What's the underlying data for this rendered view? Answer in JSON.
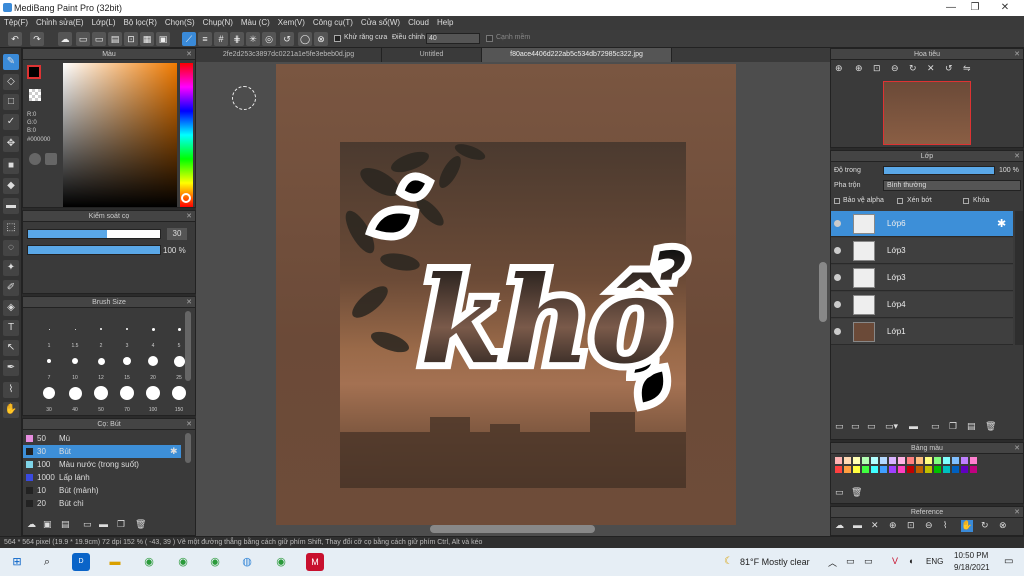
{
  "window": {
    "title": "MediBang Paint Pro (32bit)",
    "min": "—",
    "max": "❐",
    "close": "✕"
  },
  "menu": [
    "Tệp(F)",
    "Chỉnh sửa(E)",
    "Lớp(L)",
    "Bộ lọc(R)",
    "Chọn(S)",
    "Chụp(N)",
    "Màu (C)",
    "Xem(V)",
    "Công cụ(T)",
    "Cửa sổ(W)",
    "Cloud",
    "Help"
  ],
  "toolbar": {
    "antialias": "Khử răng cưa",
    "adjust_label": "Điều chỉnh",
    "adjust_value": "40",
    "soften": "Cạnh mềm"
  },
  "tabs": [
    "2fe2d253c3897dc0221a1e5fe3ebeb0d.jpg",
    "Untitled",
    "f80ace4406d222ab5c534db72985c322.jpg"
  ],
  "color_panel": {
    "title": "Màu",
    "r": "R:0",
    "g": "G:0",
    "b": "B:0",
    "hex": "#000000"
  },
  "brush_control": {
    "title": "Kiểm soát cọ",
    "size": "30",
    "opacity": "100 %",
    "size_fill": 0.6,
    "opacity_fill": 1.0
  },
  "brush_size": {
    "title": "Brush Size",
    "labels": [
      "1",
      "1.5",
      "2",
      "3",
      "4",
      "5",
      "7",
      "10",
      "12",
      "15",
      "20",
      "25",
      "30",
      "40",
      "50",
      "70",
      "100",
      "150"
    ]
  },
  "brush_list": {
    "title": "Cọ: Bút",
    "items": [
      {
        "num": "50",
        "name": "Mù",
        "color": "#e88ee0"
      },
      {
        "num": "30",
        "name": "Bút",
        "color": "#222222",
        "selected": true
      },
      {
        "num": "100",
        "name": "Màu nước (trong suốt)",
        "color": "#7fd4e8"
      },
      {
        "num": "1000",
        "name": "Lấp lánh",
        "color": "#3a4ae0"
      },
      {
        "num": "10",
        "name": "Bút (mảnh)",
        "color": "#222222"
      },
      {
        "num": "20",
        "name": "Bút chì",
        "color": "#222222"
      }
    ]
  },
  "canvas_text": "khổ",
  "navigator": {
    "title": "Hoa tiêu"
  },
  "layer_panel": {
    "title": "Lớp",
    "opacity_label": "Độ trong",
    "opacity_value": "100 %",
    "blend_label": "Pha trộn",
    "blend_value": "Bình thường",
    "protect_alpha": "Bảo vệ alpha",
    "clip": "Xén bớt",
    "lock": "Khóa",
    "layers": [
      {
        "name": "Lớp6",
        "selected": true
      },
      {
        "name": "Lớp3"
      },
      {
        "name": "Lớp3"
      },
      {
        "name": "Lớp4"
      },
      {
        "name": "Lớp1"
      }
    ]
  },
  "palette": {
    "title": "Bảng màu"
  },
  "reference": {
    "title": "Reference"
  },
  "status": "564 * 564 pixel   (19.9 * 19.9cm)   72 dpi   152 %   ( -43, 39 )   Vẽ một đường thẳng bằng cách giữ phím Shift, Thay đổi cỡ cọ bằng cách giữ phím Ctrl, Alt và kéo",
  "taskbar": {
    "weather": "81°F  Mostly clear",
    "lang": "ENG",
    "time": "10:50 PM",
    "date": "9/18/2021"
  }
}
